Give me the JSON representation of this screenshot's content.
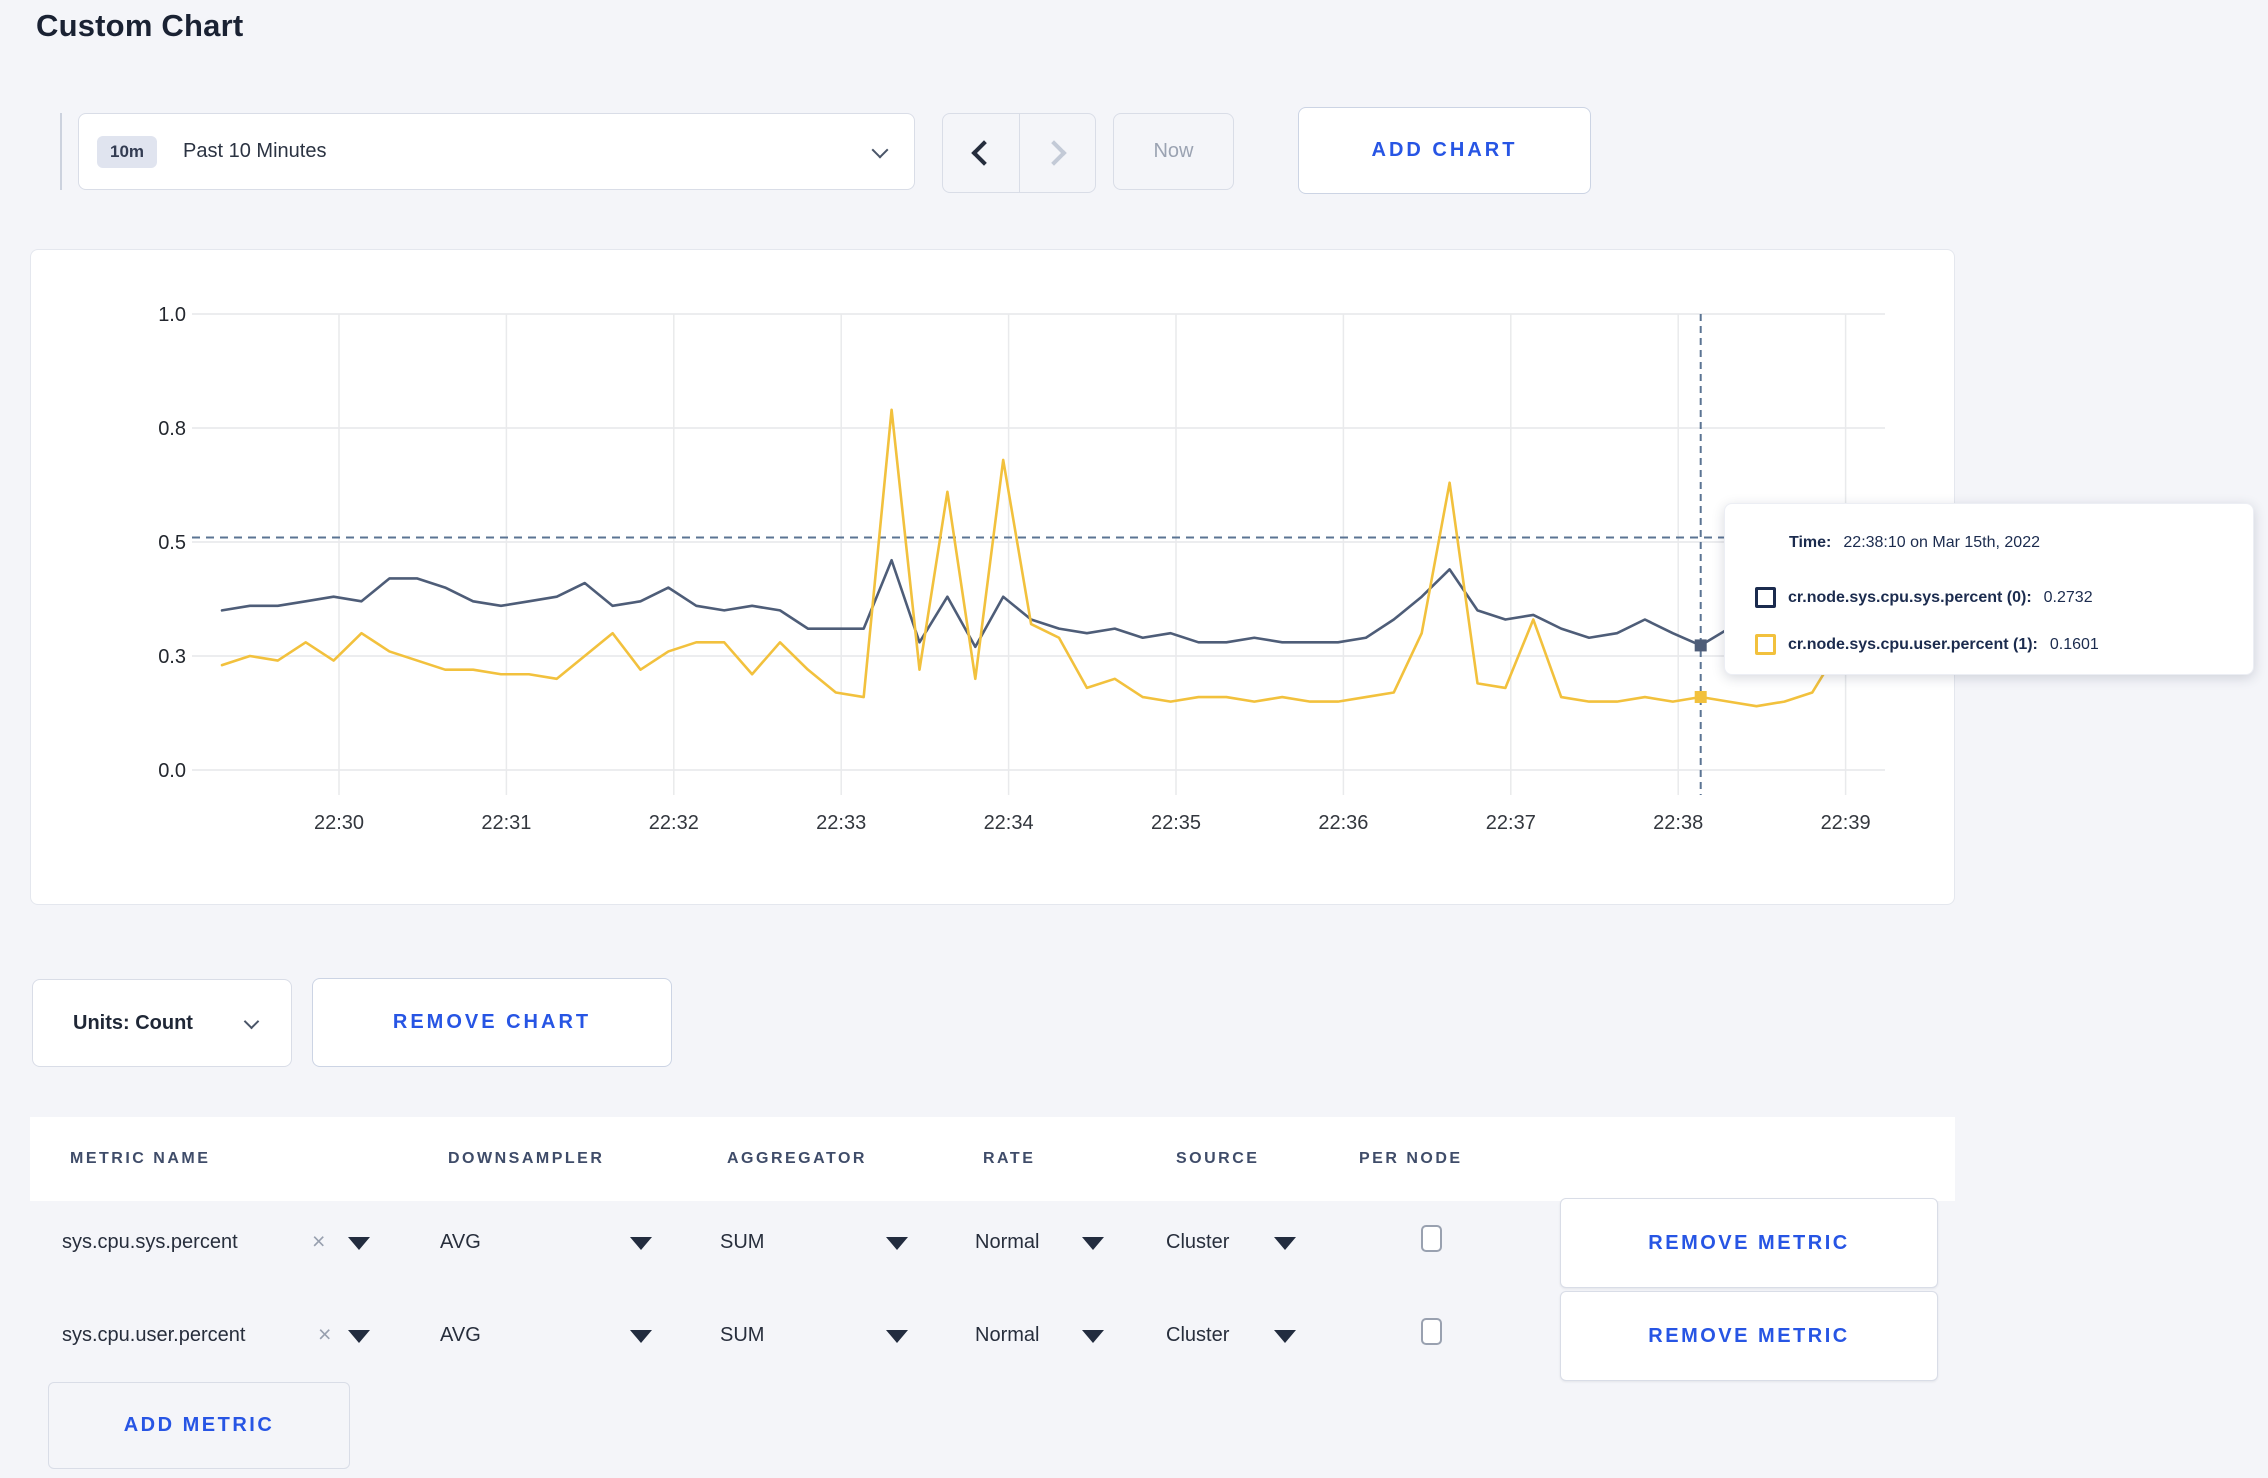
{
  "page": {
    "title": "Custom Chart",
    "background": "#f4f5f9",
    "accent_blue": "#2755e4"
  },
  "toolbar": {
    "time_badge": "10m",
    "time_label": "Past 10 Minutes",
    "now_label": "Now",
    "add_chart_label": "ADD CHART"
  },
  "chart_controls": {
    "units_label": "Units: Count",
    "remove_chart_label": "REMOVE CHART"
  },
  "tooltip": {
    "time_label": "Time:",
    "time_value": "22:38:10 on Mar 15th, 2022",
    "series": [
      {
        "label": "cr.node.sys.cpu.sys.percent (0):",
        "value": "0.2732",
        "color": "#1b2b4e"
      },
      {
        "label": "cr.node.sys.cpu.user.percent (1):",
        "value": "0.1601",
        "color": "#f2c13d"
      }
    ]
  },
  "metrics_table": {
    "headers": [
      "METRIC NAME",
      "DOWNSAMPLER",
      "AGGREGATOR",
      "RATE",
      "SOURCE",
      "PER NODE"
    ],
    "rows": [
      {
        "name": "sys.cpu.sys.percent",
        "remove": "×",
        "downsampler": "AVG",
        "aggregator": "SUM",
        "rate": "Normal",
        "source": "Cluster",
        "per_node_checked": false,
        "remove_metric_label": "REMOVE METRIC"
      },
      {
        "name": "sys.cpu.user.percent",
        "remove": "×",
        "downsampler": "AVG",
        "aggregator": "SUM",
        "rate": "Normal",
        "source": "Cluster",
        "per_node_checked": false,
        "remove_metric_label": "REMOVE METRIC"
      }
    ],
    "add_metric_label": "ADD METRIC"
  },
  "chart_data": {
    "type": "line",
    "title": "",
    "grid": true,
    "ylim": [
      0,
      1
    ],
    "yticks": [
      {
        "value": 0.0,
        "label": "0.0"
      },
      {
        "value": 0.25,
        "label": "0.3"
      },
      {
        "value": 0.5,
        "label": "0.5"
      },
      {
        "value": 0.75,
        "label": "0.8"
      },
      {
        "value": 1.0,
        "label": "1.0"
      }
    ],
    "xticks": [
      "22:30",
      "22:31",
      "22:32",
      "22:33",
      "22:34",
      "22:35",
      "22:36",
      "22:37",
      "22:38",
      "22:39"
    ],
    "x": [
      "22:29:20",
      "22:29:30",
      "22:29:40",
      "22:29:50",
      "22:30:00",
      "22:30:10",
      "22:30:20",
      "22:30:30",
      "22:30:40",
      "22:30:50",
      "22:31:00",
      "22:31:10",
      "22:31:20",
      "22:31:30",
      "22:31:40",
      "22:31:50",
      "22:32:00",
      "22:32:10",
      "22:32:20",
      "22:32:30",
      "22:32:40",
      "22:32:50",
      "22:33:00",
      "22:33:10",
      "22:33:20",
      "22:33:30",
      "22:33:40",
      "22:33:50",
      "22:34:00",
      "22:34:10",
      "22:34:20",
      "22:34:30",
      "22:34:40",
      "22:34:50",
      "22:35:00",
      "22:35:10",
      "22:35:20",
      "22:35:30",
      "22:35:40",
      "22:35:50",
      "22:36:00",
      "22:36:10",
      "22:36:20",
      "22:36:30",
      "22:36:40",
      "22:36:50",
      "22:37:00",
      "22:37:10",
      "22:37:20",
      "22:37:30",
      "22:37:40",
      "22:37:50",
      "22:38:00",
      "22:38:10",
      "22:38:20",
      "22:38:30",
      "22:38:40",
      "22:38:50",
      "22:39:00",
      "22:39:10"
    ],
    "series": [
      {
        "name": "cr.node.sys.cpu.sys.percent (0)",
        "color": "#4e5d78",
        "values": [
          0.35,
          0.36,
          0.36,
          0.37,
          0.38,
          0.37,
          0.42,
          0.42,
          0.4,
          0.37,
          0.36,
          0.37,
          0.38,
          0.41,
          0.36,
          0.37,
          0.4,
          0.36,
          0.35,
          0.36,
          0.35,
          0.31,
          0.31,
          0.31,
          0.46,
          0.28,
          0.38,
          0.27,
          0.38,
          0.33,
          0.31,
          0.3,
          0.31,
          0.29,
          0.3,
          0.28,
          0.28,
          0.29,
          0.28,
          0.28,
          0.28,
          0.29,
          0.33,
          0.38,
          0.44,
          0.35,
          0.33,
          0.34,
          0.31,
          0.29,
          0.3,
          0.33,
          0.3,
          0.2732,
          0.31,
          0.32,
          0.29,
          0.31,
          0.3,
          0.3
        ]
      },
      {
        "name": "cr.node.sys.cpu.user.percent (1)",
        "color": "#f2c13d",
        "values": [
          0.23,
          0.25,
          0.24,
          0.28,
          0.24,
          0.3,
          0.26,
          0.24,
          0.22,
          0.22,
          0.21,
          0.21,
          0.2,
          0.25,
          0.3,
          0.22,
          0.26,
          0.28,
          0.28,
          0.21,
          0.28,
          0.22,
          0.17,
          0.16,
          0.79,
          0.22,
          0.61,
          0.2,
          0.68,
          0.32,
          0.29,
          0.18,
          0.2,
          0.16,
          0.15,
          0.16,
          0.16,
          0.15,
          0.16,
          0.15,
          0.15,
          0.16,
          0.17,
          0.3,
          0.63,
          0.19,
          0.18,
          0.33,
          0.16,
          0.15,
          0.15,
          0.16,
          0.15,
          0.1601,
          0.15,
          0.14,
          0.15,
          0.17,
          0.27,
          0.24
        ]
      }
    ],
    "hover": {
      "index": 53,
      "time": "22:38:10",
      "hline_value": 0.51,
      "values": [
        0.2732,
        0.1601
      ]
    },
    "legend_position": "tooltip"
  }
}
